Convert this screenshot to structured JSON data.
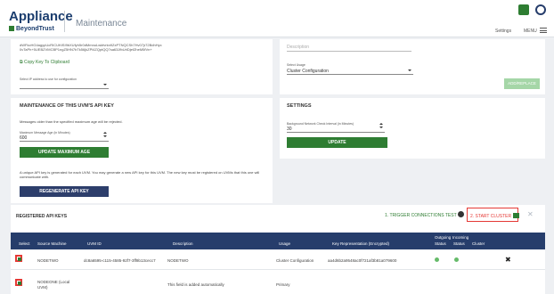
{
  "header": {
    "brand": "Appliance",
    "sub_brand": "BeyondTrust",
    "page_title": "Maintenance",
    "settings_label": "Settings",
    "menu_label": "MENU"
  },
  "key_panel": {
    "key_text": "dWFkcHG4agypUcRICUKtSI9bXUfyh5r0dMmnuLwkfvrkn9ZxPTNQCSh7Hv07jr72BdhHyc0vTaPh+5UEBZVMCBP1ngZ5HN7bTk56jkZPl4ZQptQQ7sa63JfbUrlDjefZheM5fVn+",
    "copy_label": "Copy Key To Clipboard",
    "ip_label": "Select IP address to use for configuration"
  },
  "usage_panel": {
    "description_placeholder": "Description",
    "usage_label": "Select Usage",
    "usage_value": "Cluster Configuration",
    "button_label": "ADD/REPLACE"
  },
  "maintenance_panel": {
    "title": "MAINTENANCE OF THIS UVM'S API KEY",
    "info": "Messages older than the specified maximum age will be rejected.",
    "max_age_label": "Maximum Message Age (in Minutes)",
    "max_age_value": "600",
    "update_button": "UPDATE MAXIMUM AGE",
    "regen_info": "A unique API key is generated for each UVM. You may generate a new API key for this UVM. The new key must be registered on UVMs that this one will communicate with.",
    "regen_button": "REGENERATE API KEY"
  },
  "settings_panel": {
    "title": "SETTINGS",
    "interval_label": "Background Network Check Interval (in Minutes)",
    "interval_value": "30",
    "update_button": "UPDATE"
  },
  "registered": {
    "title": "REGISTERED API KEYS",
    "trigger_label": "1. TRIGGER CONNECTIONS TEST",
    "start_label": "2. START CLUSTER",
    "columns": {
      "select": "Select",
      "source": "Source Machine",
      "uvm_id": "UVM ID",
      "description": "Description",
      "usage": "Usage",
      "key_rep": "Key Representation (Encrypted)",
      "outgoing": "Outgoing",
      "outgoing_status": "Status",
      "incoming": "Incoming",
      "incoming_status": "Status",
      "cluster": "Cluster"
    },
    "rows": [
      {
        "source": "NODETWO",
        "uvm_id": "dc8a6595-c115-4585-92f7-3ff9b13cecc7",
        "description": "NODETWO",
        "usage": "Cluster Configuration",
        "key_rep": "aa4d6b2a9548ac0f721af3b81a079600",
        "status_color": "#66bb6a",
        "delete": "✖"
      },
      {
        "source": "NODEONE (Local UVM)",
        "uvm_id": "",
        "description": "This field is added automatically",
        "usage": "Primary",
        "key_rep": ""
      }
    ]
  },
  "colors": {
    "accent_green": "#2e7d32",
    "navy": "#263d6b",
    "highlight_red": "#e53935"
  }
}
